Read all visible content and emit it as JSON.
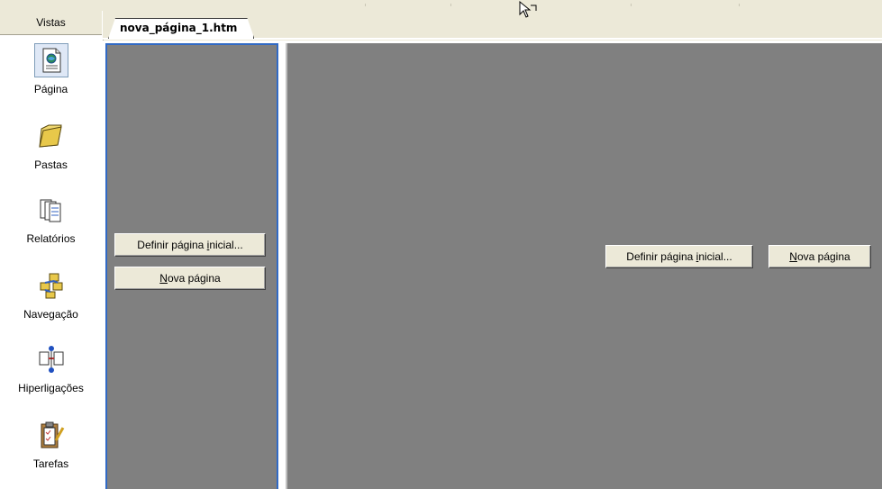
{
  "views": {
    "header": "Vistas",
    "items": [
      {
        "label": "Página",
        "icon": "page-view-icon",
        "selected": true
      },
      {
        "label": "Pastas",
        "icon": "folder-icon",
        "selected": false
      },
      {
        "label": "Relatórios",
        "icon": "reports-icon",
        "selected": false
      },
      {
        "label": "Navegação",
        "icon": "navigation-icon",
        "selected": false
      },
      {
        "label": "Hiperligações",
        "icon": "hyperlinks-icon",
        "selected": false
      },
      {
        "label": "Tarefas",
        "icon": "tasks-icon",
        "selected": false
      }
    ]
  },
  "tab": {
    "label": "nova_página_1.htm"
  },
  "left_pane": {
    "set_home_label_pre": "Definir página ",
    "set_home_label_ul": "i",
    "set_home_label_post": "nicial...",
    "new_page_label_ul": "N",
    "new_page_label_post": "ova página"
  },
  "right_pane": {
    "set_home_label_pre": "Definir página ",
    "set_home_label_ul": "i",
    "set_home_label_post": "nicial...",
    "new_page_label_ul": "N",
    "new_page_label_post": "ova página"
  },
  "colors": {
    "pane_gray": "#808080",
    "selection_blue": "#316ac5",
    "chrome": "#ece9d8"
  }
}
